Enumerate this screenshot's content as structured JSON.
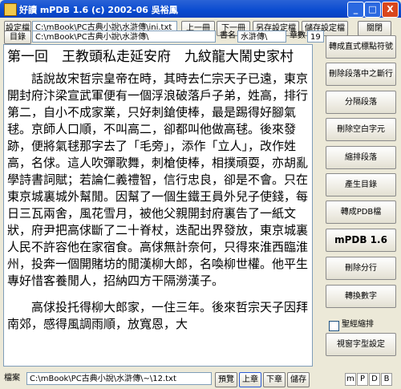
{
  "window": {
    "title": "好讀  mPDB 1.6 (c) 2002-06 吳裕鳳",
    "minimize": "_",
    "maximize": "□",
    "close": "X"
  },
  "toolbar": {
    "settings_file_label": "設定檔",
    "settings_file_value": "C:\\mBook\\PC古典小說\\水滸傳\\ini.txt",
    "prev_button": "上一冊",
    "next_button": "下一冊",
    "save_as_settings_button": "另存設定檔",
    "save_settings_button": "儲存設定檔",
    "close_button": "關閉",
    "catalog_label": "目錄",
    "catalog_value": "C:\\mBook\\PC古典小說\\水滸傳\\",
    "book_name_label": "書名",
    "book_name_value": "水滸傳\\",
    "chapter_count_label": "章數",
    "chapter_count_value": "19"
  },
  "document": {
    "title": "第一回　王教頭私走延安府　九紋龍大鬧史家村",
    "paragraph1": "話說故宋哲宗皇帝在時，其時去仁宗天子已遠，東京開封府汴梁宣武軍便有一個浮浪破落戶子弟，姓高，排行第二，自小不成家業，只好刺鎗使棒，最是踢得好腳氣毬。京師人口順，不叫高二，卻都叫他做高毬。後來發跡，便將氣毬那字去了「毛旁」，添作「立人」，改作姓高，名俅。這人吹彈歌舞，刺槍使棒，相撲頑耍，亦胡亂學詩書詞賦；若論仁義禮智，信行忠良，卻是不會。只在東京城裏城外幫閒。因幫了一個生鐵王員外兒子使錢，每日三瓦兩舍，風花雪月，被他父親開封府裏告了一紙文狀，府尹把高俅斷了二十脊杖，迭配出界發放，東京城裏人民不許容他在家宿食。高俅無計奈何，只得來淮西臨淮州，投奔一個開賭坊的閒漢柳大郎，名喚柳世權。他平生專好惜客養閒人，招納四方干隔澇漢子。",
    "paragraph2": "高俅投托得柳大郎家，一住三年。後來哲宗天子因拜南郊，感得風調雨順，放寬恩，大"
  },
  "sidebar": {
    "convert_vertical_punct": "轉成直式標點符號",
    "delete_paragraph_breaks": "刪除段落中之斷行",
    "split_paragraphs": "分隔段落",
    "delete_blank_chars": "刪除空白字元",
    "indent_paragraphs": "縮排段落",
    "generate_catalog": "產生目錄",
    "convert_pdb": "轉成PDB檔",
    "brand": "mPDB 1.6",
    "delete_page_breaks": "刪除分行",
    "convert_digits": "轉換數字",
    "indent_checkbox_label": "聖經縮排",
    "window_font_settings": "視窗字型設定"
  },
  "bottom": {
    "file_label": "檔案",
    "file_value": "C:\\mBook\\PC古典小說\\水滸傳\\~\\12.txt",
    "preview_button": "預覽",
    "prev_chapter_button": "上章",
    "next_chapter_button": "下章",
    "save_button": "儲存",
    "options": [
      "m",
      "P",
      "D",
      "B"
    ]
  }
}
